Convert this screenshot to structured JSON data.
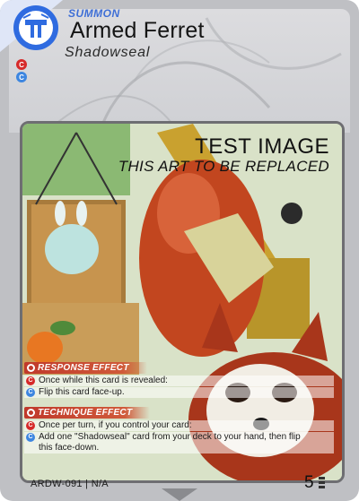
{
  "card": {
    "type_label": "SUMMON",
    "name": "Armed Ferret",
    "subtype": "Shadowseal",
    "cost_icons": [
      "C",
      "C"
    ],
    "colors": {
      "faction_blue": "#2f6be0",
      "response_red": "#c0392b",
      "technique_red": "#d04a30",
      "cost_red": "#d62a2a",
      "cost_blue": "#3d86e0"
    }
  },
  "art": {
    "title": "TEST IMAGE",
    "subtitle": "THIS ART TO BE REPLACED"
  },
  "effects": {
    "response": {
      "header": "RESPONSE EFFECT",
      "condition": "Once while this card is revealed:",
      "action": "Flip this card face-up."
    },
    "technique": {
      "header": "TECHNIQUE EFFECT",
      "condition": "Once per turn, if you control your card:",
      "action_line1": "Add one \"Shadowseal\" card from your deck to your hand, then flip",
      "action_line2": "this face-down."
    }
  },
  "footer": {
    "code": "ARDW-091 | N/A",
    "power": "5"
  }
}
